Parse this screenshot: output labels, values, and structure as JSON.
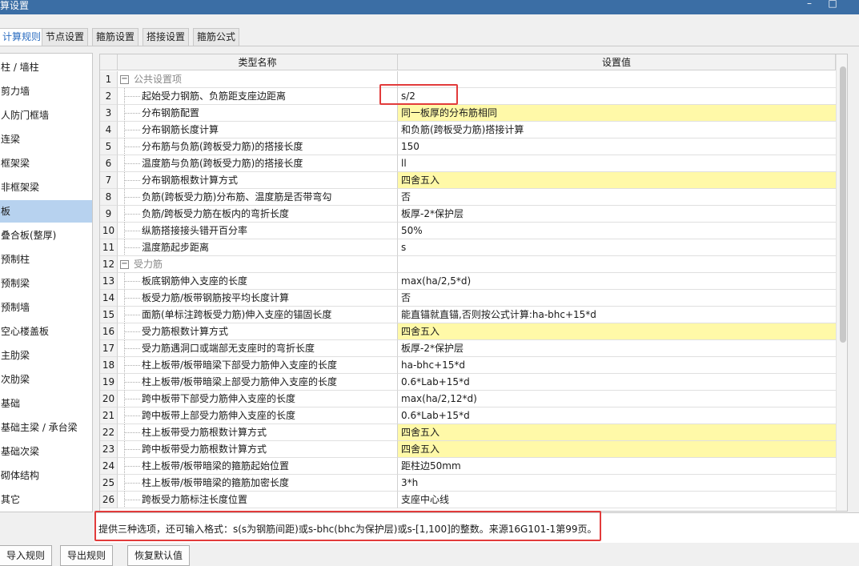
{
  "window": {
    "title": "算设置",
    "minimize": "–",
    "maximize": "□"
  },
  "tabs": [
    {
      "label": "计算规则"
    },
    {
      "label": "节点设置"
    },
    {
      "label": "箍筋设置"
    },
    {
      "label": "搭接设置"
    },
    {
      "label": "箍筋公式"
    }
  ],
  "sidebar": {
    "items": [
      {
        "label": "柱 / 墙柱"
      },
      {
        "label": "剪力墙"
      },
      {
        "label": "人防门框墙"
      },
      {
        "label": "连梁"
      },
      {
        "label": "框架梁"
      },
      {
        "label": "非框架梁"
      },
      {
        "label": "板"
      },
      {
        "label": "叠合板(整厚)"
      },
      {
        "label": "预制柱"
      },
      {
        "label": "预制梁"
      },
      {
        "label": "预制墙"
      },
      {
        "label": "空心楼盖板"
      },
      {
        "label": "主肋梁"
      },
      {
        "label": "次肋梁"
      },
      {
        "label": "基础"
      },
      {
        "label": "基础主梁 / 承台梁"
      },
      {
        "label": "基础次梁"
      },
      {
        "label": "砌体结构"
      },
      {
        "label": "其它"
      }
    ]
  },
  "grid": {
    "columns": {
      "name": "类型名称",
      "value": "设置值"
    },
    "rows": [
      {
        "num": "1",
        "name": "公共设置项",
        "value": "",
        "group": true,
        "expander": "−"
      },
      {
        "num": "2",
        "name": "起始受力钢筋、负筋距支座边距离",
        "value": "s/2"
      },
      {
        "num": "3",
        "name": "分布钢筋配置",
        "value": "同一板厚的分布筋相同",
        "highlight": true
      },
      {
        "num": "4",
        "name": "分布钢筋长度计算",
        "value": "和负筋(跨板受力筋)搭接计算"
      },
      {
        "num": "5",
        "name": "分布筋与负筋(跨板受力筋)的搭接长度",
        "value": "150"
      },
      {
        "num": "6",
        "name": "温度筋与负筋(跨板受力筋)的搭接长度",
        "value": "ll"
      },
      {
        "num": "7",
        "name": "分布钢筋根数计算方式",
        "value": "四舍五入",
        "highlight": true
      },
      {
        "num": "8",
        "name": "负筋(跨板受力筋)分布筋、温度筋是否带弯勾",
        "value": "否"
      },
      {
        "num": "9",
        "name": "负筋/跨板受力筋在板内的弯折长度",
        "value": "板厚-2*保护层"
      },
      {
        "num": "10",
        "name": "纵筋搭接接头错开百分率",
        "value": "50%"
      },
      {
        "num": "11",
        "name": "温度筋起步距离",
        "value": "s"
      },
      {
        "num": "12",
        "name": "受力筋",
        "value": "",
        "group": true,
        "expander": "−"
      },
      {
        "num": "13",
        "name": "板底钢筋伸入支座的长度",
        "value": "max(ha/2,5*d)"
      },
      {
        "num": "14",
        "name": "板受力筋/板带钢筋按平均长度计算",
        "value": "否"
      },
      {
        "num": "15",
        "name": "面筋(单标注跨板受力筋)伸入支座的锚固长度",
        "value": "能直锚就直锚,否则按公式计算:ha-bhc+15*d"
      },
      {
        "num": "16",
        "name": "受力筋根数计算方式",
        "value": "四舍五入",
        "highlight": true
      },
      {
        "num": "17",
        "name": "受力筋遇洞口或端部无支座时的弯折长度",
        "value": "板厚-2*保护层"
      },
      {
        "num": "18",
        "name": "柱上板带/板带暗梁下部受力筋伸入支座的长度",
        "value": "ha-bhc+15*d"
      },
      {
        "num": "19",
        "name": "柱上板带/板带暗梁上部受力筋伸入支座的长度",
        "value": "0.6*Lab+15*d"
      },
      {
        "num": "20",
        "name": "跨中板带下部受力筋伸入支座的长度",
        "value": "max(ha/2,12*d)"
      },
      {
        "num": "21",
        "name": "跨中板带上部受力筋伸入支座的长度",
        "value": "0.6*Lab+15*d"
      },
      {
        "num": "22",
        "name": "柱上板带受力筋根数计算方式",
        "value": "四舍五入",
        "highlight": true
      },
      {
        "num": "23",
        "name": "跨中板带受力筋根数计算方式",
        "value": "四舍五入",
        "highlight": true
      },
      {
        "num": "24",
        "name": "柱上板带/板带暗梁的箍筋起始位置",
        "value": "距柱边50mm"
      },
      {
        "num": "25",
        "name": "柱上板带/板带暗梁的箍筋加密长度",
        "value": "3*h"
      },
      {
        "num": "26",
        "name": "跨板受力筋标注长度位置",
        "value": "支座中心线"
      }
    ]
  },
  "hint": {
    "text": "提供三种选项，还可输入格式：s(s为钢筋间距)或s-bhc(bhc为保护层)或s-[1,100]的整数。来源16G101-1第99页。"
  },
  "buttons": {
    "import": "导入规则",
    "export": "导出规则",
    "reset": "恢复默认值"
  },
  "colors": {
    "titlebar": "#3b6ea5",
    "highlight": "#fff9a8",
    "selected": "#b7d2ef",
    "annotation": "#e23b3b"
  }
}
